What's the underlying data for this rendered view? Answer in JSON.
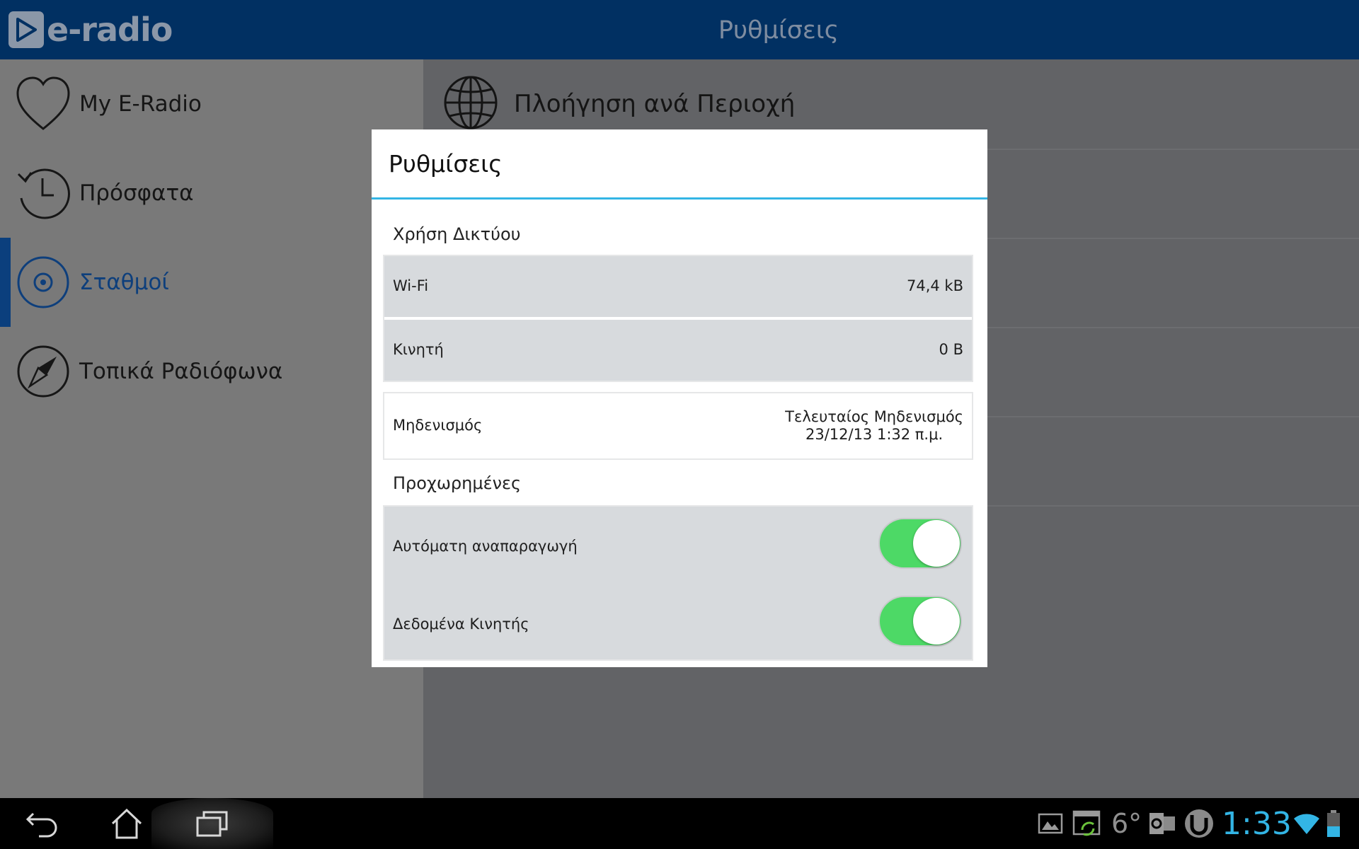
{
  "app": {
    "logo_text": "e-radio",
    "header_title": "Ρυθμίσεις"
  },
  "sidebar": {
    "items": [
      {
        "label": "My E-Radio",
        "icon": "heart-icon",
        "active": false
      },
      {
        "label": "Πρόσφατα",
        "icon": "history-icon",
        "active": false
      },
      {
        "label": "Σταθμοί",
        "icon": "radio-target-icon",
        "active": true
      },
      {
        "label": "Τοπικά Ραδιόφωνα",
        "icon": "compass-icon",
        "active": false
      }
    ]
  },
  "main": {
    "rows": [
      {
        "label": "Πλοήγηση ανά Περιοχή",
        "icon": "globe-icon"
      }
    ]
  },
  "dialog": {
    "title": "Ρυθμίσεις",
    "network_section": "Χρήση Δικτύου",
    "wifi_label": "Wi-Fi",
    "wifi_value": "74,4 kB",
    "mobile_label": "Κινητή",
    "mobile_value": "0 B",
    "reset_label": "Μηδενισμός",
    "reset_value_line1": "Τελευταίος Μηδενισμός",
    "reset_value_line2": "23/12/13 1:32 π.μ.",
    "advanced_section": "Προχωρημένες",
    "autoplay_label": "Αυτόματη αναπαραγωγή",
    "autoplay_on": true,
    "mobile_data_label": "Δεδομένα Κινητής",
    "mobile_data_on": true
  },
  "status_bar": {
    "temperature": "6°",
    "time": "1:33",
    "icons": [
      "gallery-icon",
      "screenshot-icon",
      "weather-icon",
      "outlook-icon",
      "torrent-icon",
      "wifi-icon",
      "battery-icon"
    ]
  },
  "colors": {
    "accent": "#33b5e5",
    "toggle_on": "#4dd966",
    "brand_blue": "#0050a0",
    "active_item": "#0e3f7c"
  }
}
